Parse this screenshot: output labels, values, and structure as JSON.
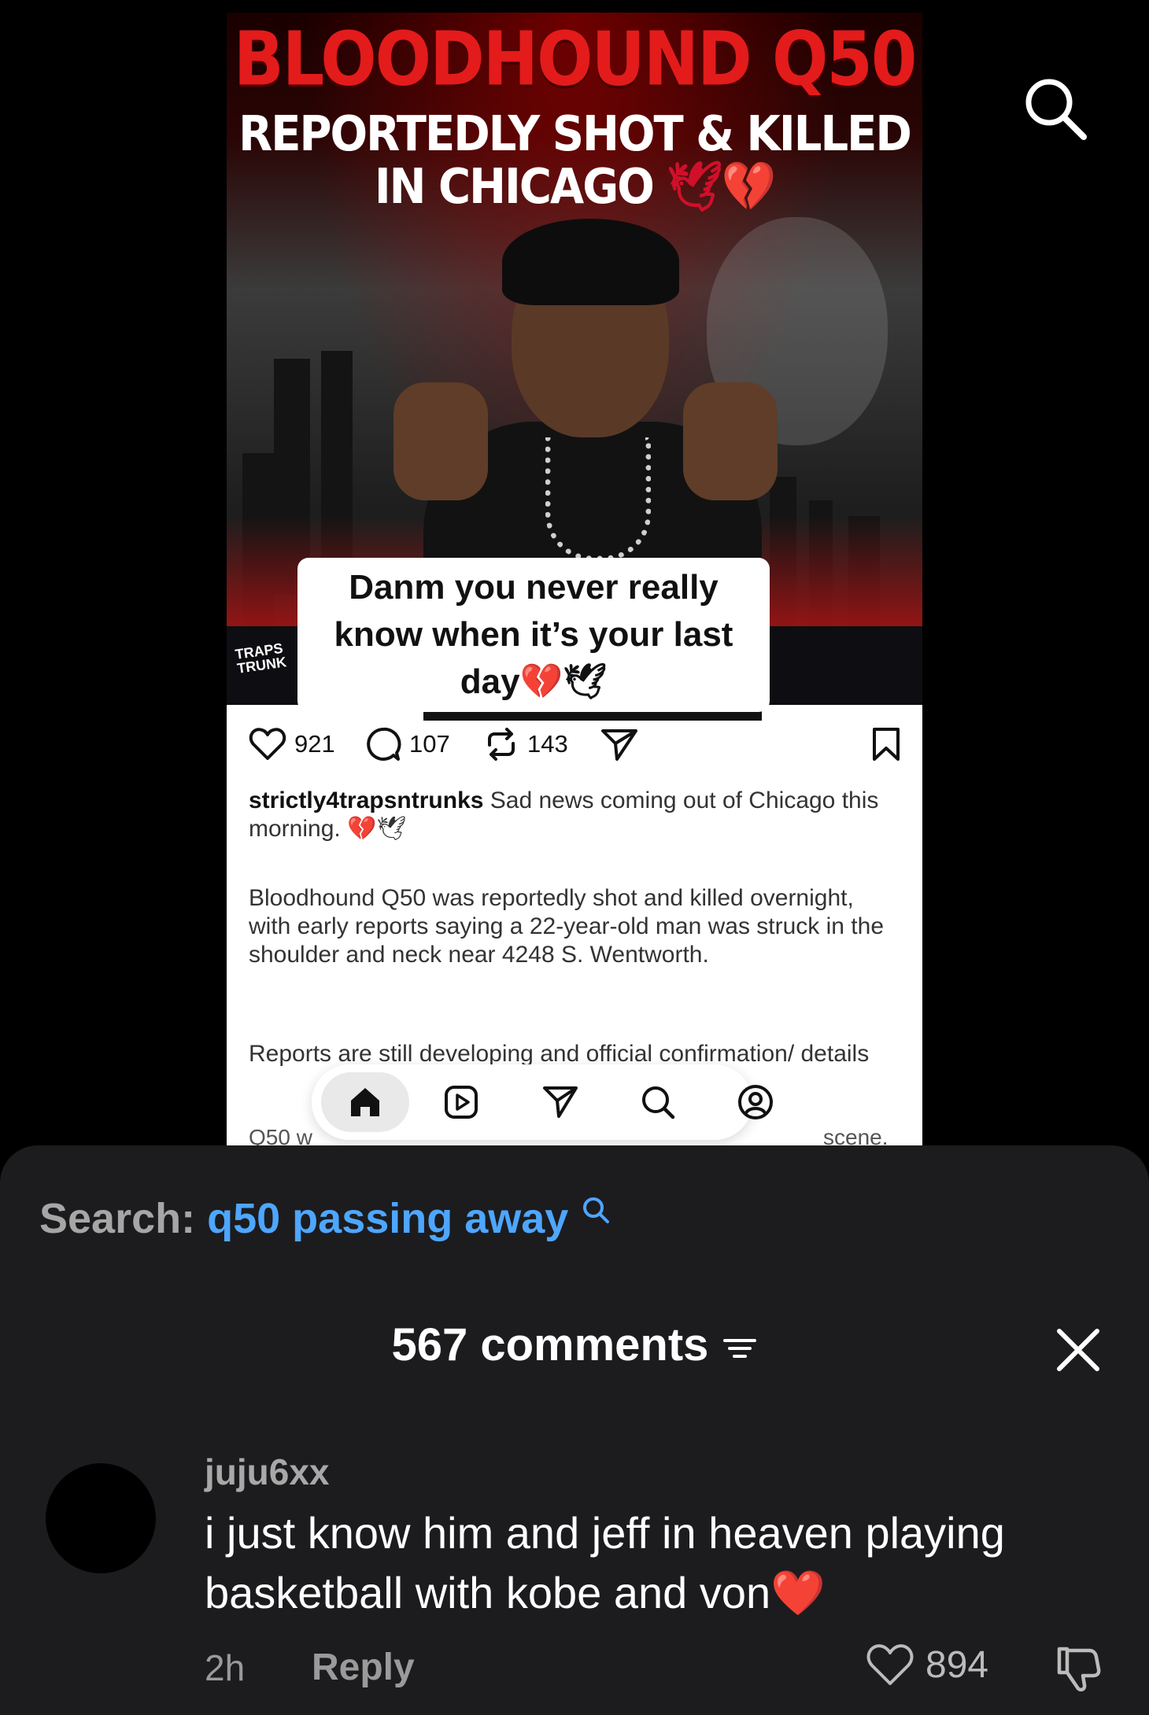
{
  "post": {
    "headline_name": "BLOODHOUND Q50",
    "headline_line2": "REPORTEDLY SHOT & KILLED",
    "headline_line3": "IN CHICAGO",
    "headline_emoji": "🕊💔",
    "overlay_caption_line1": "Danm you never really",
    "overlay_caption_line2": "know when it’s your last",
    "overlay_caption_line3": "day💔🕊",
    "watermark": "TRAPS TRUNK",
    "likes": "921",
    "comments": "107",
    "reposts": "143",
    "caption_user": "strictly4trapsntrunks",
    "caption_text": "Sad news coming out of Chicago this morning. 💔🕊",
    "paragraph2": "Bloodhound Q50 was reportedly shot and killed overnight, with early reports saying a 22-year-old man was struck in the shoulder and neck near 4248 S. Wentworth.",
    "paragraph3": "Reports are still developing and official confirmation/ details",
    "paragraph4_start": "Q50 w",
    "paragraph4_end": "scene."
  },
  "icons": {
    "top_search": "search-icon",
    "like": "heart-icon",
    "comment": "comment-bubble-icon",
    "repost": "repost-icon",
    "share": "send-icon",
    "bookmark": "bookmark-icon",
    "nav": [
      "home-icon",
      "reels-icon",
      "send-icon",
      "search-icon",
      "profile-icon"
    ]
  },
  "sheet": {
    "search_label": "Search:",
    "search_query": "q50 passing away",
    "comments_count_title": "567 comments",
    "comment": {
      "username": "juju6xx",
      "text": "i just know him and jeff in heaven playing basketball with kobe and von❤️",
      "time": "2h",
      "reply_label": "Reply",
      "likes": "894"
    }
  },
  "colors": {
    "link_blue": "#4ea6ff",
    "headline_red": "#e31b1b",
    "sheet_bg": "#1c1c1e"
  }
}
